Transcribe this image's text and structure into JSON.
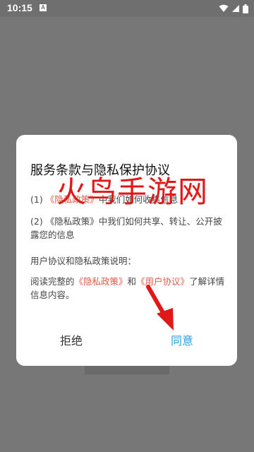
{
  "status_bar": {
    "time": "10:15",
    "notification_icon_letter": "A",
    "icons": [
      "wifi-icon",
      "signal-icon",
      "battery-icon"
    ]
  },
  "dialog": {
    "title": "服务条款与隐私保护协议",
    "items": [
      {
        "prefix": "(1) ",
        "link": "《隐私政策》",
        "text": "中我们如何收集信息"
      },
      {
        "prefix": "(2) ",
        "link": "《隐私政策》",
        "text": "中我们如何共享、转让、公开披露您的信息"
      }
    ],
    "explanation_heading": "用户协议和隐私政策说明：",
    "read_prefix": "阅读完整的",
    "privacy_link": "《隐私政策》",
    "and_text": "和",
    "user_agreement_link": "《用户协议》",
    "read_suffix": "了解详情信息内容。",
    "reject_label": "拒绝",
    "agree_label": "同意"
  },
  "watermark": {
    "text": "火鸟手游网"
  },
  "colors": {
    "overlay": "#777777",
    "link": "#e05b4b",
    "agree": "#2aa3e6",
    "watermark": "#e01818"
  }
}
